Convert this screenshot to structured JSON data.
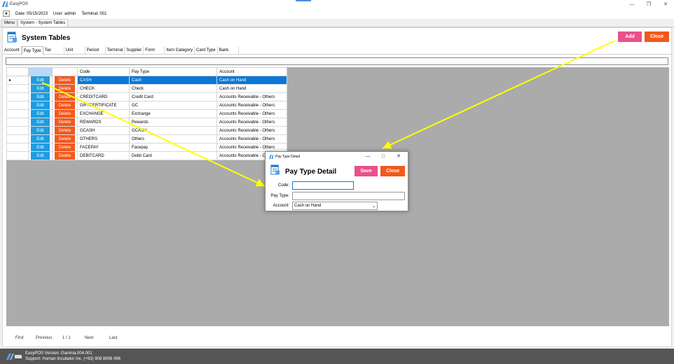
{
  "window": {
    "title": "EasyPOS"
  },
  "infobar": {
    "date": "Date: 05/15/2023",
    "user": "User: admin",
    "terminal": "Terminal: 001"
  },
  "doc_tabs": [
    {
      "label": "Menu"
    },
    {
      "label": "System - System Tables"
    }
  ],
  "page": {
    "title": "System Tables",
    "add_label": "Add",
    "close_label": "Close"
  },
  "sub_tabs": [
    {
      "label": "Account"
    },
    {
      "label": "Pay Type"
    },
    {
      "label": "Tax"
    },
    {
      "label": "Unit"
    },
    {
      "label": "Period"
    },
    {
      "label": "Terminal"
    },
    {
      "label": "Supplier"
    },
    {
      "label": "Form"
    },
    {
      "label": "Item Category"
    },
    {
      "label": "Card Type"
    },
    {
      "label": "Bank"
    }
  ],
  "grid": {
    "headers": {
      "code": "Code",
      "pay_type": "Pay Type",
      "account": "Account"
    },
    "edit_label": "Edit",
    "delete_label": "Delete",
    "rows": [
      {
        "code": "CASH",
        "pay_type": "Cash",
        "account": "Cash on Hand"
      },
      {
        "code": "CHECK",
        "pay_type": "Check",
        "account": "Cash on Hand"
      },
      {
        "code": "CREDITCARD",
        "pay_type": "Credit Card",
        "account": "Accounts Receivable - Others"
      },
      {
        "code": "GIFTCERTIFICATE",
        "pay_type": "GC",
        "account": "Accounts Receivable - Others"
      },
      {
        "code": "EXCHANGE",
        "pay_type": "Exchange",
        "account": "Accounts Receivable - Others"
      },
      {
        "code": "REWARDS",
        "pay_type": "Rewards",
        "account": "Accounts Receivable - Others"
      },
      {
        "code": "GCASH",
        "pay_type": "GCASH",
        "account": "Accounts Receivable - Others"
      },
      {
        "code": "OTHERS",
        "pay_type": "Others",
        "account": "Accounts Receivable - Others"
      },
      {
        "code": "FACEPAY",
        "pay_type": "Facepay",
        "account": "Accounts Receivable - Others"
      },
      {
        "code": "DEBITCARD",
        "pay_type": "Debit Card",
        "account": "Accounts Receivable - Others"
      }
    ]
  },
  "pager": {
    "first": "First",
    "previous": "Previous",
    "page": "1 / 1",
    "next": "Next",
    "last": "Last"
  },
  "status": {
    "version": "EasyPOS Version: Gamma.004.001",
    "support": "Support: Human Incubator Inc. (+63) 908 8906 496"
  },
  "dialog": {
    "window_title": "Pay Type Detail",
    "heading": "Pay Type Detail",
    "save_label": "Save",
    "close_label": "Close",
    "code_label": "Code:",
    "code_value": "",
    "pay_type_label": "Pay Type:",
    "pay_type_value": "",
    "account_label": "Account:",
    "account_value": "Cash on Hand"
  },
  "colors": {
    "add": "#e9518a",
    "close": "#f2591c",
    "edit": "#1e9ddf",
    "selection": "#0a78d6",
    "arrow": "#ffff00"
  }
}
